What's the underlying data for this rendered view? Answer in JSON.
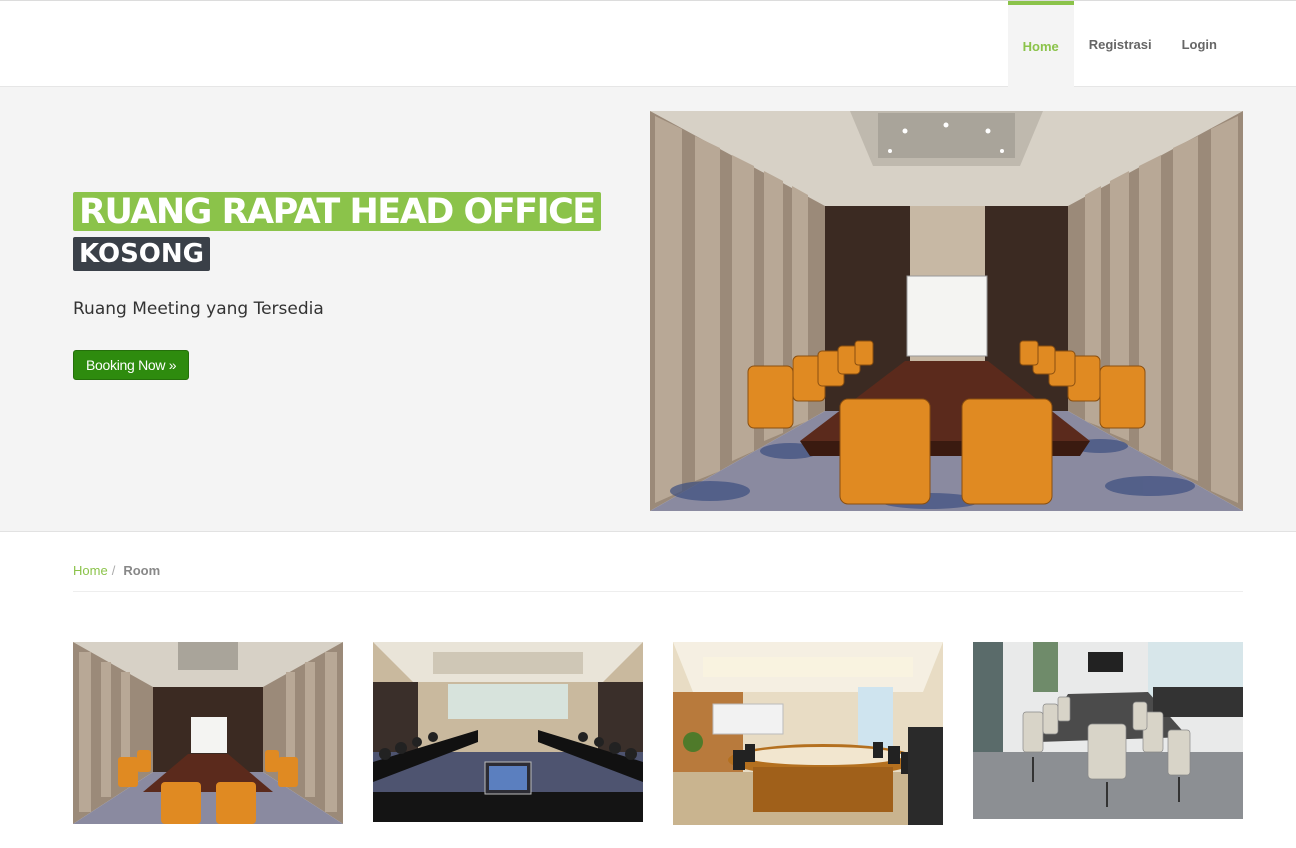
{
  "nav": {
    "items": [
      {
        "label": "Home",
        "active": true
      },
      {
        "label": "Registrasi",
        "active": false
      },
      {
        "label": "Login",
        "active": false
      }
    ]
  },
  "hero": {
    "title": "RUANG RAPAT HEAD OFFICE",
    "status": "KOSONG",
    "subtitle": "Ruang Meeting yang Tersedia",
    "button_label": "Booking Now »"
  },
  "breadcrumb": {
    "home": "Home",
    "separator": "/",
    "current": "Room"
  },
  "rooms": [
    {
      "image": "conference-room-orange-chairs"
    },
    {
      "image": "conference-room-black-tables-laptop"
    },
    {
      "image": "boardroom-oval-wood-table"
    },
    {
      "image": "modern-meeting-room-gray"
    }
  ],
  "colors": {
    "accent": "#8bc34a",
    "status_bg": "#3a4048",
    "button": "#2e8b0e"
  }
}
